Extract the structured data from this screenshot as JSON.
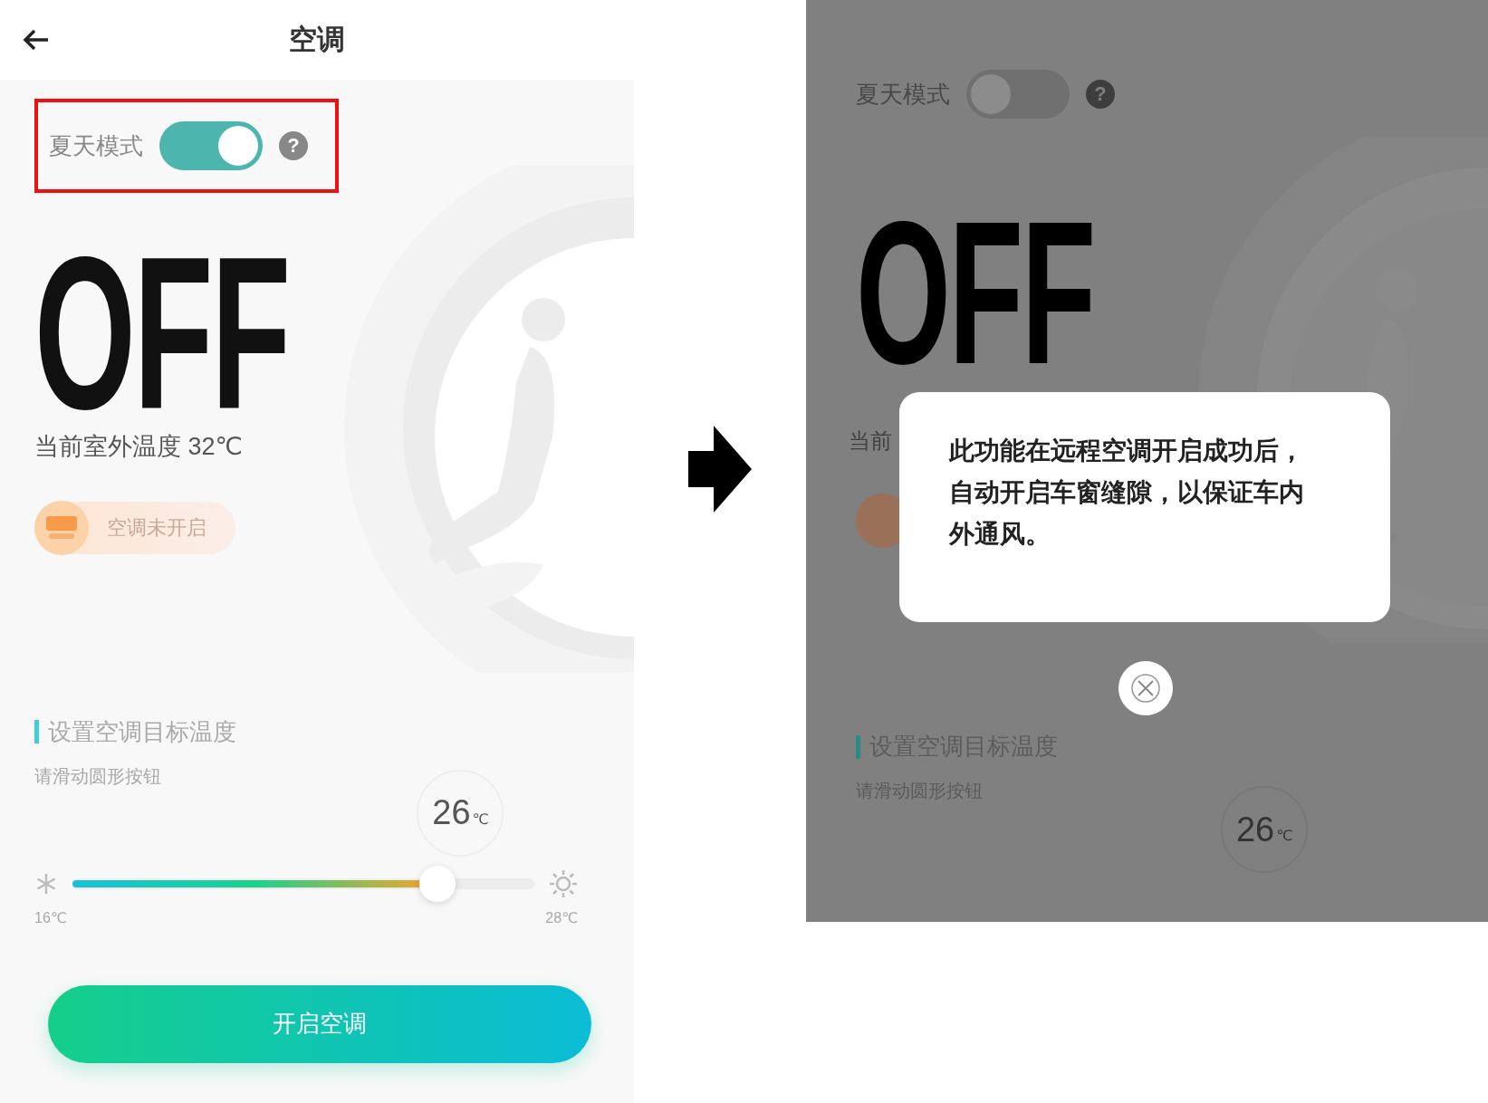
{
  "left_screen": {
    "header": {
      "title": "空调"
    },
    "summer_mode": {
      "label": "夏天模式",
      "on": true,
      "highlighted": true,
      "help": "?"
    },
    "ac_status": "OFF",
    "outdoor_temp": "当前室外温度 32℃",
    "status_badge": {
      "label": "空调未开启"
    },
    "target": {
      "title": "设置空调目标温度",
      "hint": "请滑动圆形按钮",
      "value": "26",
      "unit": "℃",
      "level": 0.79,
      "min": "16℃",
      "max": "28℃"
    },
    "start_button": "开启空调"
  },
  "right_screen": {
    "summer_mode": {
      "label": "夏天模式",
      "on": false,
      "help": "?"
    },
    "ac_status": "OFF",
    "outdoor_temp": "当前",
    "dialog": {
      "text": "此功能在远程空调开启成功后，自动开启车窗缝隙，以保证车内外通风。"
    },
    "target": {
      "title": "设置空调目标温度",
      "hint": "请滑动圆形按钮",
      "value": "26",
      "unit": "℃"
    }
  }
}
